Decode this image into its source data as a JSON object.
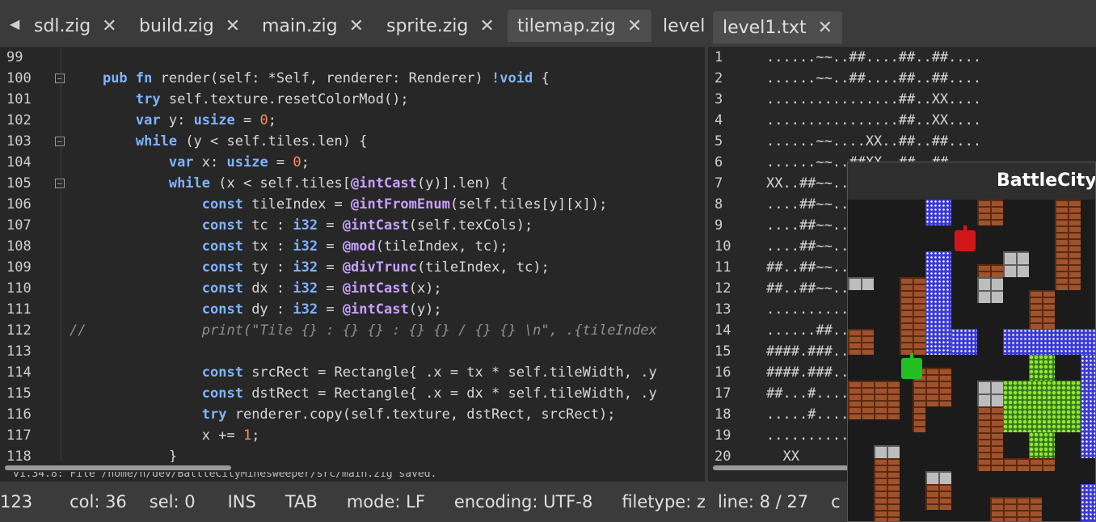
{
  "left": {
    "tabs": [
      {
        "label": "sdl.zig",
        "active": false
      },
      {
        "label": "build.zig",
        "active": false
      },
      {
        "label": "main.zig",
        "active": false
      },
      {
        "label": "sprite.zig",
        "active": false
      },
      {
        "label": "tilemap.zig",
        "active": true
      },
      {
        "label": "level",
        "active": false
      }
    ],
    "lines": [
      {
        "n": "99",
        "fold": false,
        "html": ""
      },
      {
        "n": "100",
        "fold": true,
        "html": "    <span class='kw'>pub fn</span> render(self: *Self, renderer: Renderer) <span class='kw'>!void</span> {"
      },
      {
        "n": "101",
        "fold": false,
        "html": "        <span class='kw'>try</span> self.texture.resetColorMod();"
      },
      {
        "n": "102",
        "fold": false,
        "html": "        <span class='kw'>var</span> y: <span class='ty'>usize</span> = <span class='num'>0</span>;"
      },
      {
        "n": "103",
        "fold": true,
        "html": "        <span class='kw'>while</span> (y &lt; self.tiles.len) {"
      },
      {
        "n": "104",
        "fold": false,
        "html": "            <span class='kw'>var</span> x: <span class='ty'>usize</span> = <span class='num'>0</span>;"
      },
      {
        "n": "105",
        "fold": true,
        "html": "            <span class='kw'>while</span> (x &lt; self.tiles[<span class='bi'>@intCast</span>(y)].len) {"
      },
      {
        "n": "106",
        "fold": false,
        "html": "                <span class='kw'>const</span> tileIndex = <span class='bi'>@intFromEnum</span>(self.tiles[y][x]);"
      },
      {
        "n": "107",
        "fold": false,
        "html": "                <span class='kw'>const</span> tc : <span class='ty'>i32</span> = <span class='bi'>@intCast</span>(self.texCols);"
      },
      {
        "n": "108",
        "fold": false,
        "html": "                <span class='kw'>const</span> tx : <span class='ty'>i32</span> = <span class='bi'>@mod</span>(tileIndex, tc);"
      },
      {
        "n": "109",
        "fold": false,
        "html": "                <span class='kw'>const</span> ty : <span class='ty'>i32</span> = <span class='bi'>@divTrunc</span>(tileIndex, tc);"
      },
      {
        "n": "110",
        "fold": false,
        "html": "                <span class='kw'>const</span> dx : <span class='ty'>i32</span> = <span class='bi'>@intCast</span>(x);"
      },
      {
        "n": "111",
        "fold": false,
        "html": "                <span class='kw'>const</span> dy : <span class='ty'>i32</span> = <span class='bi'>@intCast</span>(y);"
      },
      {
        "n": "112",
        "fold": false,
        "html": "<span class='cm'>//              print(\"Tile {} : {} {} : {} {} / {} {} \\n\", .{tileIndex</span>"
      },
      {
        "n": "113",
        "fold": false,
        "html": ""
      },
      {
        "n": "114",
        "fold": false,
        "html": "                <span class='kw'>const</span> srcRect = Rectangle{ .x = tx * self.tileWidth, .y"
      },
      {
        "n": "115",
        "fold": false,
        "html": "                <span class='kw'>const</span> dstRect = Rectangle{ .x = dx * self.tileWidth, .y"
      },
      {
        "n": "116",
        "fold": false,
        "html": "                <span class='kw'>try</span> renderer.copy(self.texture, dstRect, srcRect);"
      },
      {
        "n": "117",
        "fold": false,
        "html": "                x += <span class='num'>1</span>;"
      },
      {
        "n": "118",
        "fold": false,
        "html": "            }"
      }
    ],
    "message": "v1.34.8: File /home/h/dev/BattleCityMinesweeper/src/main.zig saved.",
    "status": {
      "line": "123",
      "col": "col: 36",
      "sel": "sel: 0",
      "ins": "INS",
      "tab": "TAB",
      "mode": "mode: LF",
      "encoding": "encoding: UTF-8",
      "filetype": "filetype: z"
    }
  },
  "right": {
    "tab": {
      "label": "level1.txt"
    },
    "lines": [
      {
        "n": "1",
        "t": "......~~..##....##..##...."
      },
      {
        "n": "2",
        "t": "......~~..##....##..##...."
      },
      {
        "n": "3",
        "t": "................##..XX...."
      },
      {
        "n": "4",
        "t": "................##..XX...."
      },
      {
        "n": "5",
        "t": "......~~....XX..##..##...."
      },
      {
        "n": "6",
        "t": "......~~..##XX..##..##...."
      },
      {
        "n": "7",
        "t": "XX..##~~..................."
      },
      {
        "n": "8",
        "t": "....##~~.................."
      },
      {
        "n": "9",
        "t": "....##~~.................."
      },
      {
        "n": "10",
        "t": "....##~~.................."
      },
      {
        "n": "11",
        "t": "##..##~~.................."
      },
      {
        "n": "12",
        "t": "##..##~~.................."
      },
      {
        "n": "13",
        "t": "........................."
      },
      {
        "n": "14",
        "t": "......##................."
      },
      {
        "n": "15",
        "t": "####.###................."
      },
      {
        "n": "16",
        "t": "####.###................."
      },
      {
        "n": "17",
        "t": "##...#..................."
      },
      {
        "n": "18",
        "t": ".....#..................."
      },
      {
        "n": "19",
        "t": "........................."
      },
      {
        "n": "20",
        "t": "  XX"
      }
    ],
    "status": {
      "line": "line: 8 / 27",
      "col": "c"
    }
  },
  "game": {
    "title": "BattleCityMinesweeper",
    "colors": {
      "brick": "#a0522d",
      "steel": "#bdbdbd",
      "water": "#3a3ad6",
      "trees": "#2e7d1a",
      "enemy_tank": "#d01818",
      "player_tank": "#22c022"
    }
  }
}
